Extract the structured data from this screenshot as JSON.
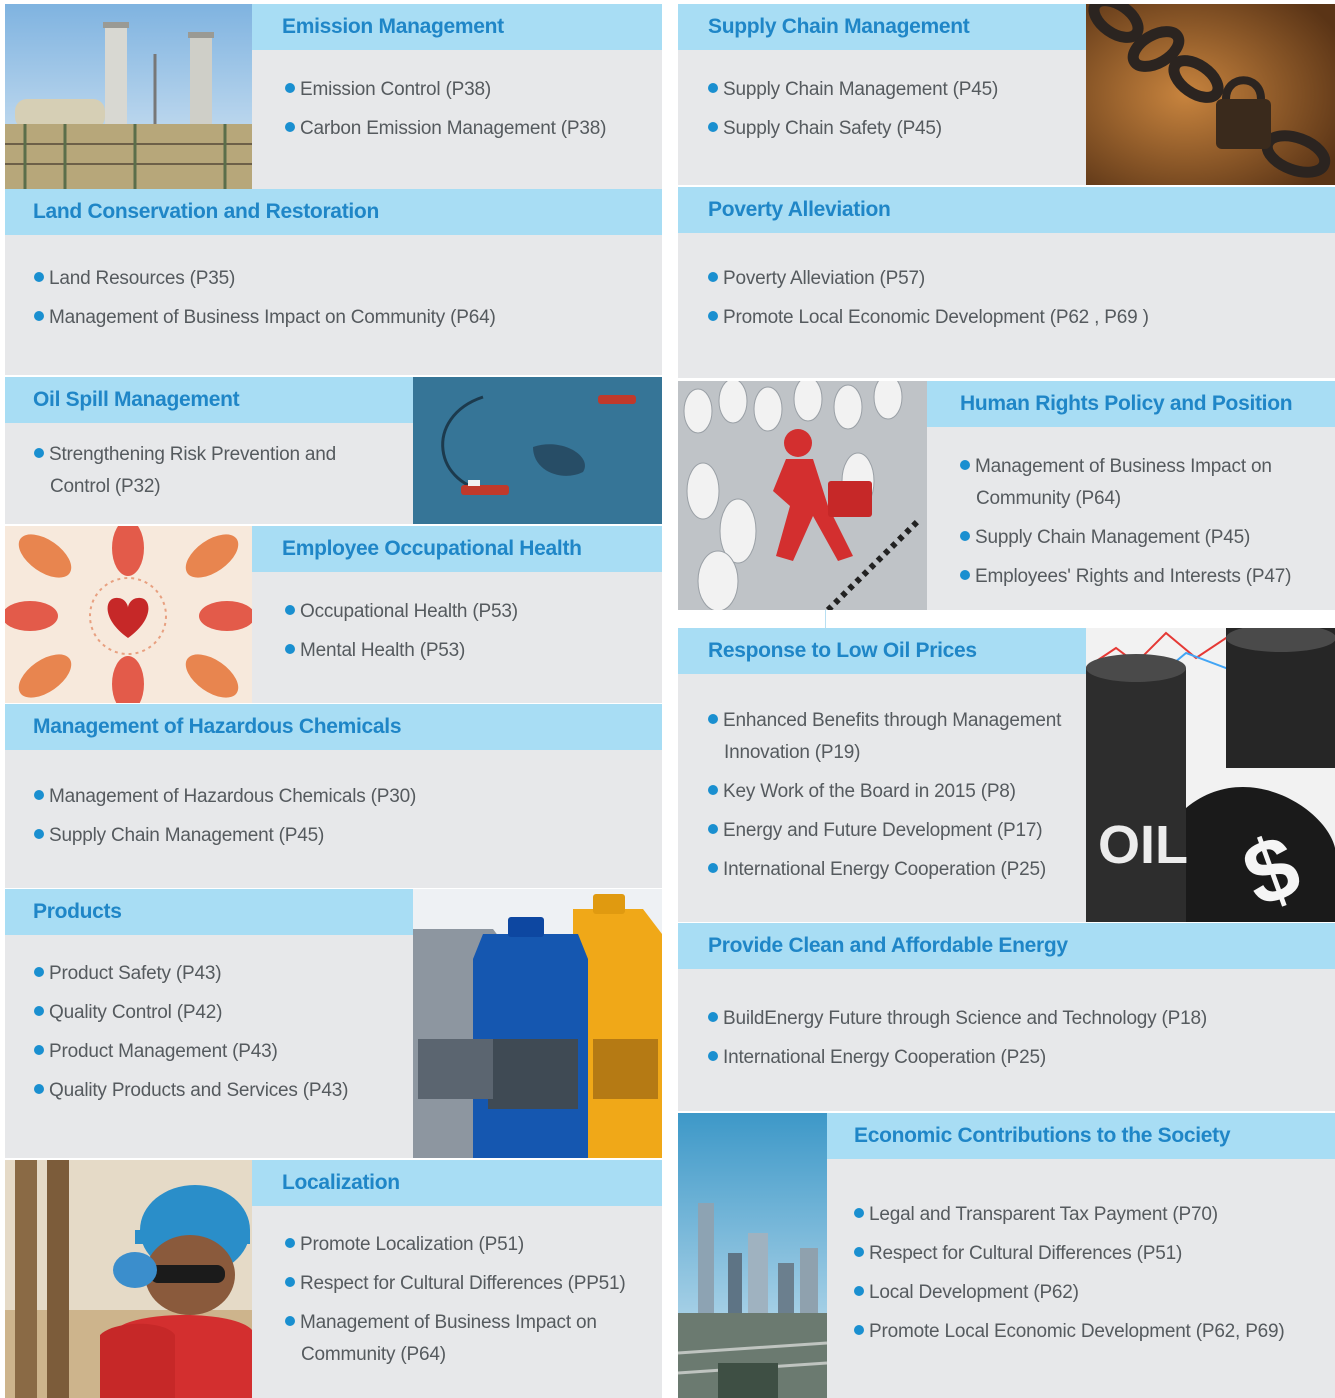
{
  "left": [
    {
      "key": "emission",
      "title": "Emission Management",
      "items": [
        "Emission Control (P38)",
        "Carbon Emission Management (P38)"
      ],
      "image": "refinery-towers-photo"
    },
    {
      "key": "land",
      "title": "Land Conservation and Restoration",
      "items": [
        "Land Resources (P35)",
        "Management of Business Impact on Community (P64)"
      ]
    },
    {
      "key": "oil-spill",
      "title": "Oil Spill Management",
      "items": [
        "Strengthening Risk Prevention and Control (P32)"
      ],
      "image": "oil-spill-sea-photo"
    },
    {
      "key": "health",
      "title": "Employee  Occupational Health",
      "items": [
        "Occupational Health (P53)",
        "Mental Health (P53)"
      ],
      "image": "hands-heart-illustration"
    },
    {
      "key": "chemicals",
      "title": "Management of Hazardous Chemicals",
      "items": [
        "Management of Hazardous Chemicals (P30)",
        "Supply Chain Management (P45)"
      ]
    },
    {
      "key": "products",
      "title": "Products",
      "items": [
        "Product Safety (P43)",
        "Quality Control (P42)",
        "Product Management (P43)",
        "Quality Products and Services (P43)"
      ],
      "image": "lubricant-bottles-photo"
    },
    {
      "key": "localization",
      "title": "Localization",
      "items": [
        "Promote Localization (P51)",
        "Respect for Cultural Differences (PP51)",
        "Management of Business Impact on Community (P64)"
      ],
      "image": "workers-hardhat-photo"
    }
  ],
  "right": [
    {
      "key": "supply",
      "title": "Supply Chain Management",
      "items": [
        "Supply Chain Management (P45)",
        "Supply Chain Safety (P45)"
      ],
      "image": "chain-lock-photo"
    },
    {
      "key": "poverty",
      "title": "Poverty Alleviation",
      "items": [
        "Poverty Alleviation (P57)",
        "Promote Local Economic Development (P62 , P69 )"
      ]
    },
    {
      "key": "human-rights",
      "title": "Human Rights Policy and Position",
      "items": [
        "Management of Business Impact on Community (P64)",
        "Supply Chain Management (P45)",
        "Employees' Rights and Interests (P47)"
      ],
      "image": "red-figure-walking-illustration"
    },
    {
      "key": "low-oil",
      "title": "Response to Low Oil Prices",
      "items": [
        "Enhanced Benefits through Management Innovation (P19)",
        "Key Work of the Board in 2015 (P8)",
        "Energy and Future Development (P17)",
        "International Energy Cooperation (P25)"
      ],
      "image": "oil-barrels-photo"
    },
    {
      "key": "clean-energy",
      "title": "Provide Clean and Affordable Energy",
      "items": [
        "BuildEnergy Future through Science and Technology (P18)",
        "International Energy Cooperation (P25)"
      ]
    },
    {
      "key": "economic",
      "title": "Economic Contributions to the Society",
      "items": [
        "Legal and Transparent Tax Payment (P70)",
        "Respect for Cultural Differences (P51)",
        "Local Development (P62)",
        "Promote Local Economic Development (P62, P69)"
      ],
      "image": "city-skyline-photo"
    }
  ],
  "barrel_label": "OIL"
}
